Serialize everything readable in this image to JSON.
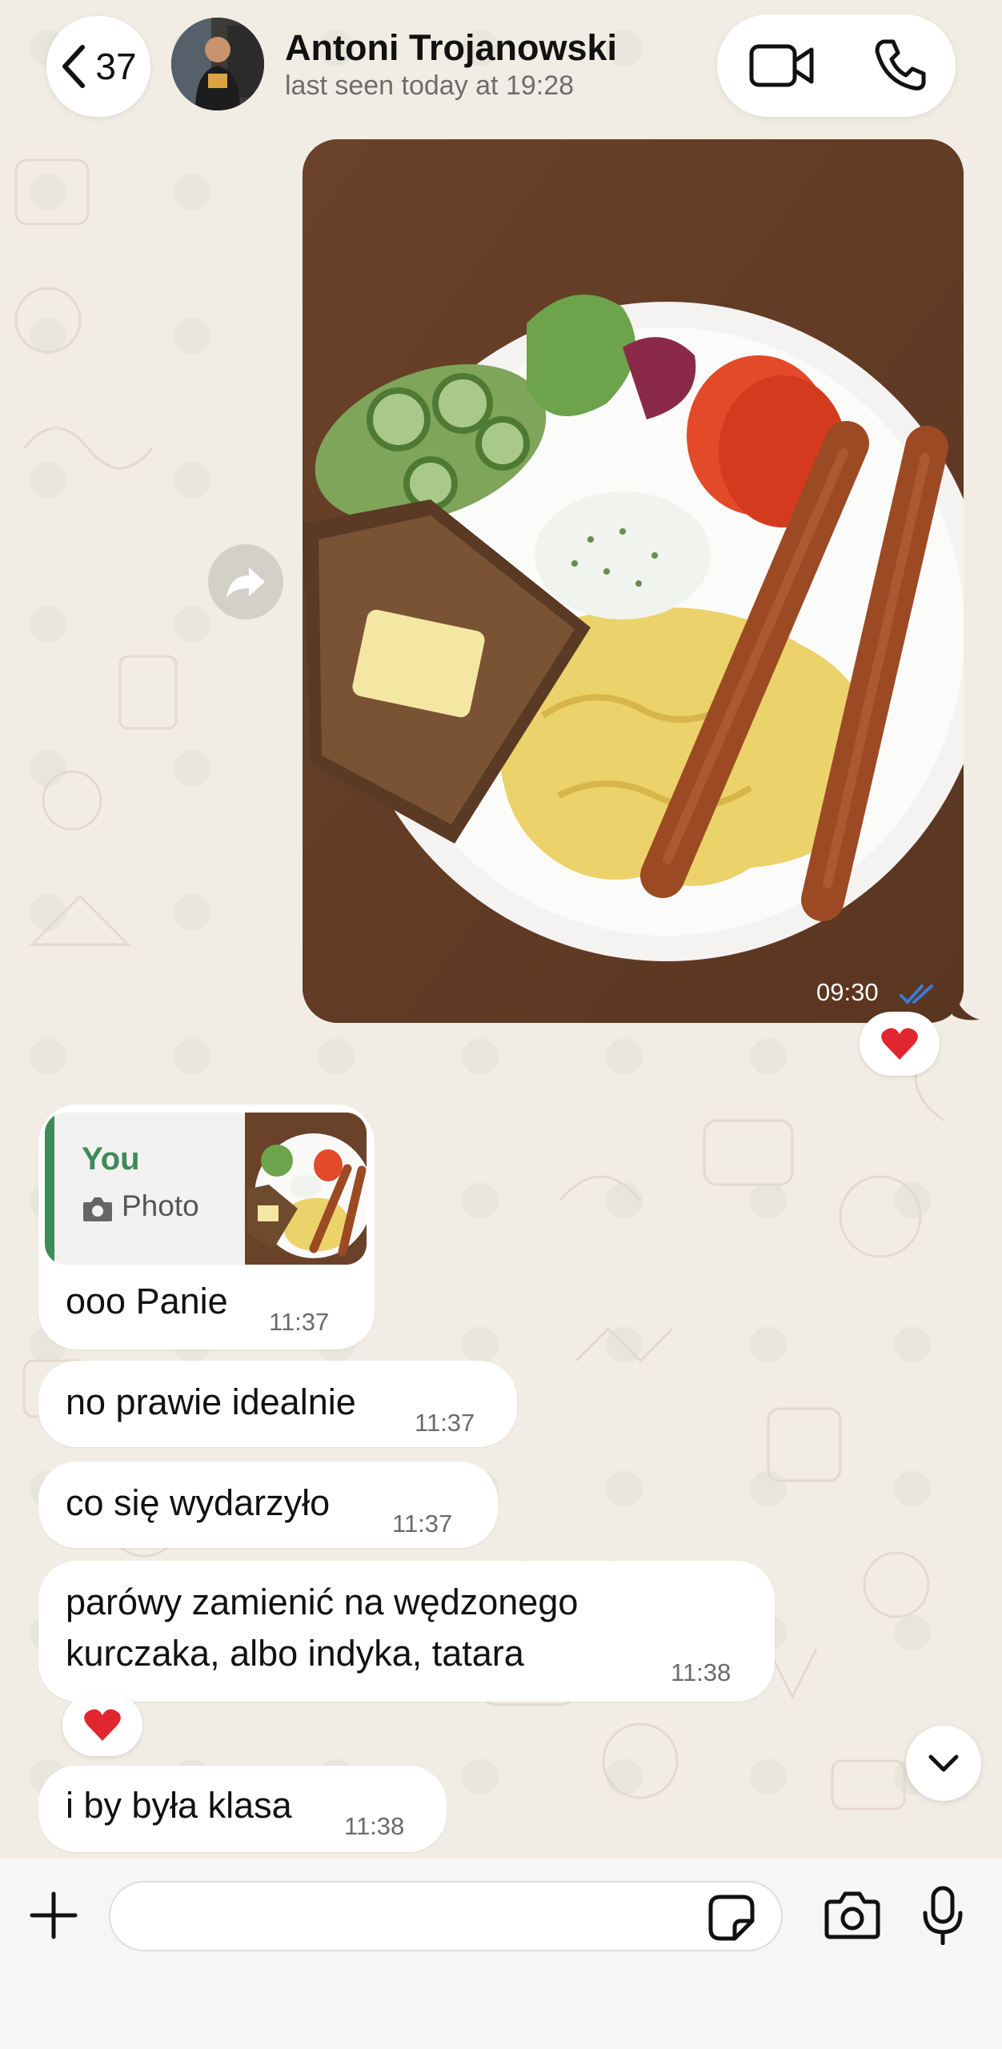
{
  "header": {
    "back_count": "37",
    "contact_name": "Antoni Trojanowski",
    "status": "last seen today at 19:28"
  },
  "photo_message": {
    "time": "09:30",
    "status": "read",
    "reaction": "❤️"
  },
  "messages": [
    {
      "quote": {
        "author": "You",
        "type_label": "Photo"
      },
      "text": "ooo Panie",
      "time": "11:37"
    },
    {
      "text": "no prawie idealnie",
      "time": "11:37"
    },
    {
      "text": "co się wydarzyło",
      "time": "11:37"
    },
    {
      "text_line1": "parówy zamienić na wędzonego",
      "text_line2": "kurczaka, albo indyka, tatara",
      "time": "11:38",
      "reaction": "❤️"
    },
    {
      "text": "i by była klasa",
      "time": "11:38"
    }
  ],
  "composer": {
    "placeholder": ""
  },
  "colors": {
    "accent": "#3e8a58",
    "read_ticks": "#3a7bd5",
    "heart": "#e0262e"
  }
}
